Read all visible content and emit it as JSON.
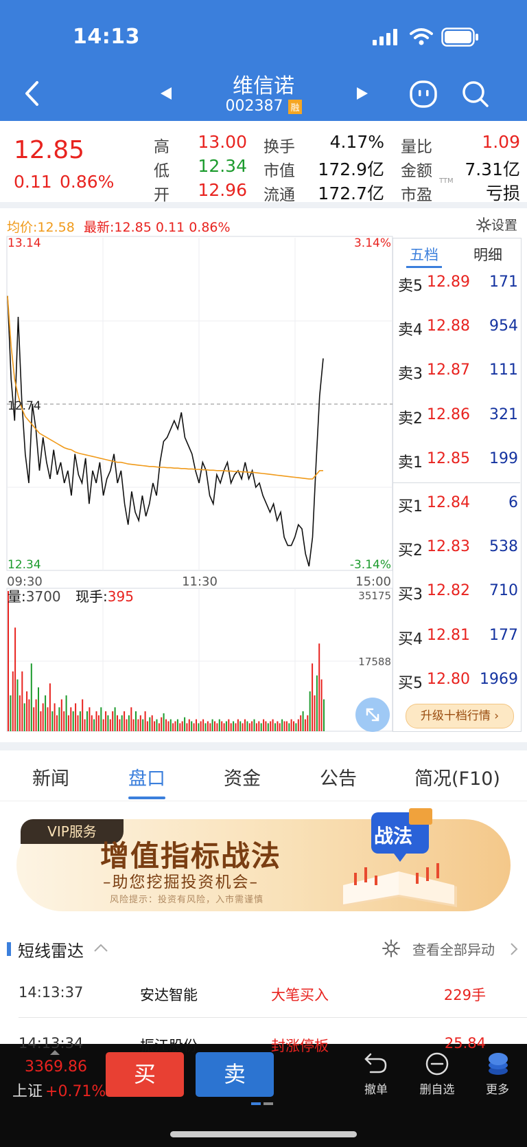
{
  "status_bar": {
    "time": "14:13"
  },
  "header": {
    "name": "维信诺",
    "code": "002387",
    "badge": "融"
  },
  "quote": {
    "price": "12.85",
    "change": "0.11",
    "change_pct": "0.86%",
    "fields": [
      {
        "label": "高",
        "value": "13.00",
        "color": "#e8231f"
      },
      {
        "label": "低",
        "value": "12.34",
        "color": "#1c9b2d"
      },
      {
        "label": "开",
        "value": "12.96",
        "color": "#e8231f"
      },
      {
        "label": "换手",
        "value": "4.17%"
      },
      {
        "label": "市值",
        "value": "172.9亿"
      },
      {
        "label": "流通",
        "value": "172.7亿"
      },
      {
        "label": "量比",
        "value": "1.09",
        "color": "#e8231f"
      },
      {
        "label": "金额",
        "value": "7.31亿"
      },
      {
        "label": "市盈",
        "sup": "TTM",
        "value": "亏损"
      }
    ]
  },
  "chart_info": {
    "avg_label": "均价:12.58",
    "latest_label": "最新:12.85",
    "latest_change": "0.11",
    "latest_pct": "0.86%",
    "settings": "设置"
  },
  "chart_data": {
    "type": "line",
    "price_high": "13.14",
    "price_low": "12.34",
    "pct_high": "3.14%",
    "pct_low": "-3.14%",
    "prev_close": "12.74",
    "x_labels": [
      "09:30",
      "11:30",
      "15:00"
    ],
    "ylim": [
      12.34,
      13.14
    ],
    "series": [
      {
        "values": [
          13.0,
          12.8,
          12.7,
          12.95,
          12.75,
          12.62,
          12.55,
          12.74,
          12.68,
          12.58,
          12.66,
          12.6,
          12.56,
          12.63,
          12.57,
          12.6,
          12.55,
          12.58,
          12.52,
          12.62,
          12.57,
          12.55,
          12.61,
          12.5,
          12.58,
          12.55,
          12.6,
          12.52,
          12.56,
          12.58,
          12.62,
          12.55,
          12.58,
          12.5,
          12.45,
          12.53,
          12.48,
          12.46,
          12.52,
          12.47,
          12.5,
          12.55,
          12.52,
          12.6,
          12.65,
          12.66,
          12.68,
          12.7,
          12.68,
          12.72,
          12.66,
          12.64,
          12.62,
          12.58,
          12.55,
          12.6,
          12.58,
          12.52,
          12.5,
          12.57,
          12.55,
          12.58,
          12.6,
          12.55,
          12.57,
          12.58,
          12.56,
          12.6,
          12.56,
          12.58,
          12.54,
          12.55,
          12.52,
          12.5,
          12.48,
          12.5,
          12.46,
          12.48,
          12.42,
          12.4,
          12.4,
          12.42,
          12.45,
          12.44,
          12.38,
          12.35,
          12.42,
          12.6,
          12.76,
          12.85
        ]
      },
      {
        "values": [
          13.0,
          12.88,
          12.8,
          12.76,
          12.73,
          12.71,
          12.7,
          12.69,
          12.68,
          12.67,
          12.665,
          12.66,
          12.655,
          12.65,
          12.645,
          12.64,
          12.635,
          12.632,
          12.63,
          12.625,
          12.622,
          12.62,
          12.618,
          12.616,
          12.614,
          12.612,
          12.61,
          12.608,
          12.606,
          12.604,
          12.602,
          12.6,
          12.6,
          12.598,
          12.596,
          12.595,
          12.594,
          12.593,
          12.592,
          12.591,
          12.59,
          12.59,
          12.589,
          12.588,
          12.588,
          12.587,
          12.587,
          12.586,
          12.586,
          12.585,
          12.585,
          12.584,
          12.584,
          12.583,
          12.583,
          12.582,
          12.582,
          12.581,
          12.581,
          12.58,
          12.58,
          12.58,
          12.579,
          12.579,
          12.578,
          12.578,
          12.577,
          12.577,
          12.576,
          12.576,
          12.575,
          12.574,
          12.573,
          12.572,
          12.571,
          12.57,
          12.569,
          12.568,
          12.567,
          12.566,
          12.565,
          12.564,
          12.563,
          12.562,
          12.561,
          12.56,
          12.56,
          12.57,
          12.58,
          12.58
        ]
      }
    ],
    "volume": {
      "label": "量:",
      "value": "3700",
      "hand_label": "现手:",
      "hand_value": "395",
      "axis_max": "35175",
      "axis_mid": "17588",
      "bars": [
        35175,
        9000,
        15000,
        26000,
        13000,
        9000,
        15000,
        7000,
        10000,
        8000,
        17000,
        6000,
        8000,
        11000,
        5000,
        7000,
        9000,
        6000,
        12000,
        5000,
        7000,
        4000,
        6000,
        8000,
        5000,
        9000,
        4000,
        6000,
        5000,
        7000,
        4000,
        5000,
        8000,
        3000,
        5000,
        6000,
        4000,
        3000,
        5000,
        4000,
        6000,
        3000,
        5000,
        4000,
        3000,
        5000,
        6000,
        4000,
        3000,
        4000,
        5000,
        3000,
        4000,
        6000,
        3000,
        5000,
        3000,
        4000,
        3000,
        5000,
        2500,
        3500,
        4000,
        2500,
        3000,
        2000,
        3500,
        4500,
        3000,
        2500,
        3000,
        2000,
        2500,
        3000,
        2000,
        2500,
        3500,
        2000,
        3000,
        2500,
        2000,
        3000,
        2000,
        2500,
        3000,
        2000,
        2500,
        2000,
        3000,
        2500,
        2000,
        3000,
        2500,
        2000,
        2500,
        3000,
        2000,
        2500,
        2000,
        3000,
        2500,
        2000,
        3000,
        2500,
        2000,
        2500,
        3000,
        2000,
        2500,
        2000,
        3000,
        2500,
        2000,
        2500,
        3000,
        2000,
        2500,
        2000,
        3000,
        2500,
        2500,
        2000,
        3000,
        2500,
        2000,
        3000,
        4000,
        5000,
        3000,
        4000,
        10000,
        17000,
        9000,
        14000,
        22000,
        13000,
        8000
      ],
      "colors": "alt"
    }
  },
  "orderbook": {
    "tabs": [
      "五档",
      "明细"
    ],
    "sells": [
      {
        "label": "卖5",
        "price": "12.89",
        "vol": "171"
      },
      {
        "label": "卖4",
        "price": "12.88",
        "vol": "954"
      },
      {
        "label": "卖3",
        "price": "12.87",
        "vol": "111"
      },
      {
        "label": "卖2",
        "price": "12.86",
        "vol": "321"
      },
      {
        "label": "卖1",
        "price": "12.85",
        "vol": "199"
      }
    ],
    "buys": [
      {
        "label": "买1",
        "price": "12.84",
        "vol": "6"
      },
      {
        "label": "买2",
        "price": "12.83",
        "vol": "538"
      },
      {
        "label": "买3",
        "price": "12.82",
        "vol": "710"
      },
      {
        "label": "买4",
        "price": "12.81",
        "vol": "177"
      },
      {
        "label": "买5",
        "price": "12.80",
        "vol": "1969"
      }
    ],
    "upgrade": "升级十档行情"
  },
  "tabs": [
    "新闻",
    "盘口",
    "资金",
    "公告",
    "简况(F10)"
  ],
  "banner": {
    "vip": "VIP服务",
    "title": "增值指标战法",
    "subtitle": "–助您挖掘投资机会–",
    "risk": "风险提示：投资有风险，入市需谨慎",
    "badge": "战法"
  },
  "radar": {
    "title": "短线雷达",
    "view_all": "查看全部异动",
    "rows": [
      {
        "time": "14:13:37",
        "name": "安达智能",
        "event": "大笔买入",
        "value": "229手"
      },
      {
        "time": "14:13:34",
        "name": "振江股份",
        "event": "封涨停板",
        "value": "25.84"
      }
    ]
  },
  "bottom": {
    "index_value": "3369.86",
    "index_name": "上证",
    "index_change": "+0.71%",
    "buy": "买",
    "sell": "卖",
    "undo": "撤单",
    "remove_fav": "删自选",
    "more": "更多"
  }
}
